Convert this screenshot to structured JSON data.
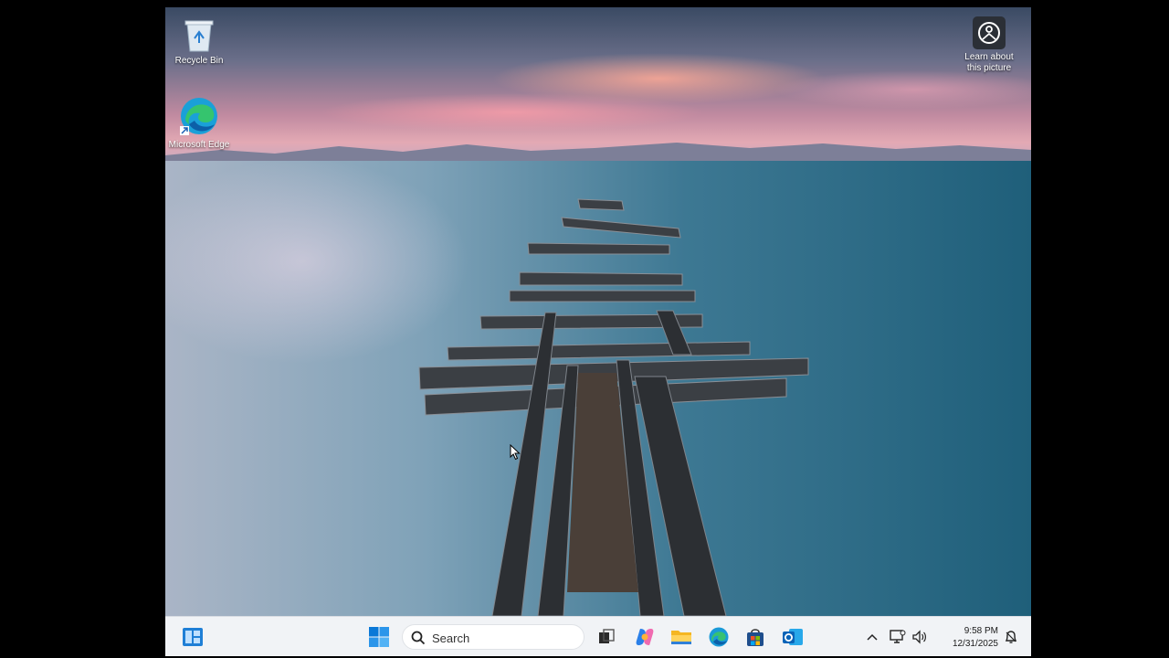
{
  "desktop": {
    "icons": [
      {
        "label": "Recycle Bin",
        "icon": "recycle-bin-icon"
      },
      {
        "label": "Microsoft Edge",
        "icon": "edge-icon"
      },
      {
        "label": "Learn about this picture",
        "icon": "learn-about-picture-icon"
      }
    ]
  },
  "taskbar": {
    "search_placeholder": "Search",
    "pinned": [
      "widgets-icon",
      "windows-start-icon",
      "task-view-icon",
      "copilot-icon",
      "file-explorer-icon",
      "edge-icon",
      "store-icon",
      "outlook-icon"
    ],
    "tray": [
      "show-hidden-icons-chevron",
      "network-icon",
      "volume-icon",
      "notification-bell-icon"
    ],
    "clock": {
      "time": "9:58 PM",
      "date": "12/31/2025"
    }
  },
  "colors": {
    "taskbar_bg": "#f1f3f6",
    "accent": "#0078d4"
  }
}
